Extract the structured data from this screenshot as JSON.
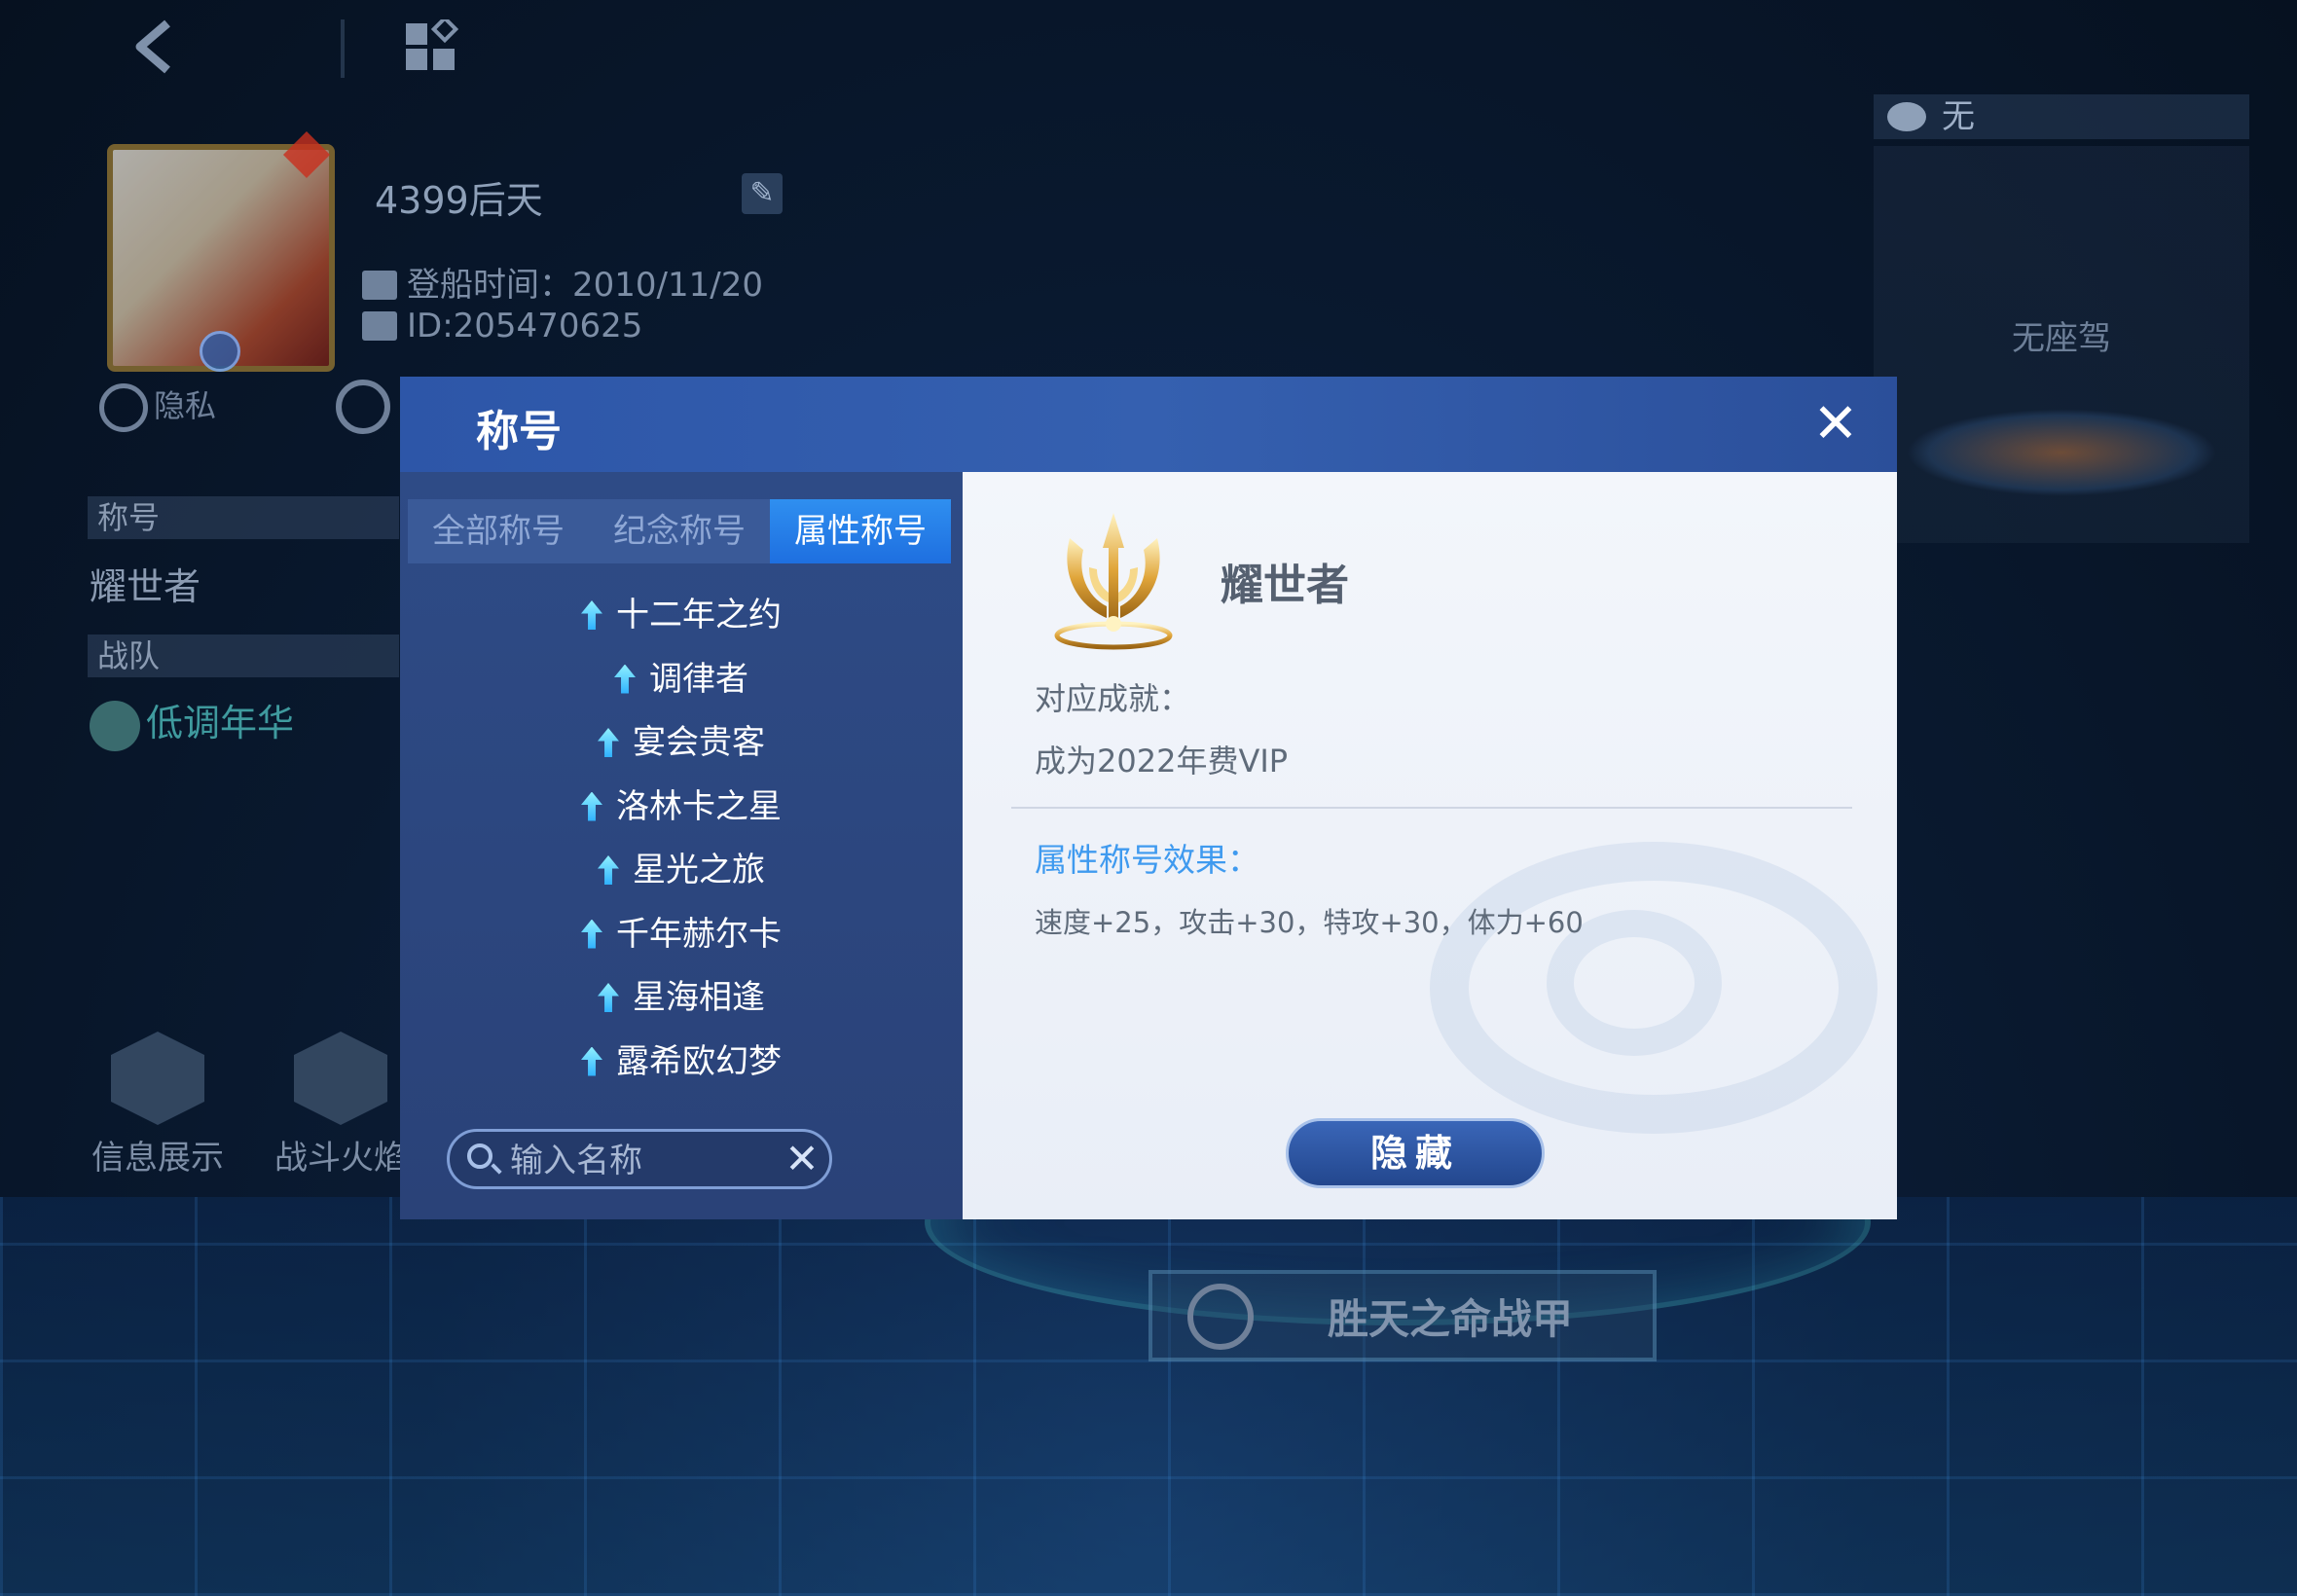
{
  "profile": {
    "name": "4399后天",
    "join_date": "登船时间：2010/11/20",
    "id": "ID:205470625",
    "privacy_label": "隐私",
    "title_label": "称号",
    "title_value": "耀世者",
    "team_label": "战队",
    "team_value": "低调年华"
  },
  "bottom_buttons": [
    {
      "label": "信息展示"
    },
    {
      "label": "战斗火焰"
    }
  ],
  "mount": {
    "header": "无",
    "empty_text": "无座驾"
  },
  "armor_button": "胜天之命战甲",
  "dialog": {
    "title": "称号",
    "close_glyph": "✕",
    "tabs": [
      {
        "label": "全部称号",
        "active": false
      },
      {
        "label": "纪念称号",
        "active": false
      },
      {
        "label": "属性称号",
        "active": true
      }
    ],
    "titles": [
      "十二年之约",
      "调律者",
      "宴会贵客",
      "洛林卡之星",
      "星光之旅",
      "千年赫尔卡",
      "星海相逢",
      "露希欧幻梦"
    ],
    "search": {
      "placeholder": "输入名称",
      "value": "",
      "clear_glyph": "✕"
    },
    "detail": {
      "name": "耀世者",
      "achievement_label": "对应成就：",
      "achievement_value": "成为2022年费VIP",
      "effect_label": "属性称号效果：",
      "effect_value": "速度+25，攻击+30，特攻+30，体力+60",
      "hide_button": "隐藏"
    }
  },
  "colors": {
    "dialog_header": "#3560b0",
    "tab_active": "#2f8ff0",
    "effect_label": "#3f9aef",
    "hide_button": "#2f56a0"
  }
}
